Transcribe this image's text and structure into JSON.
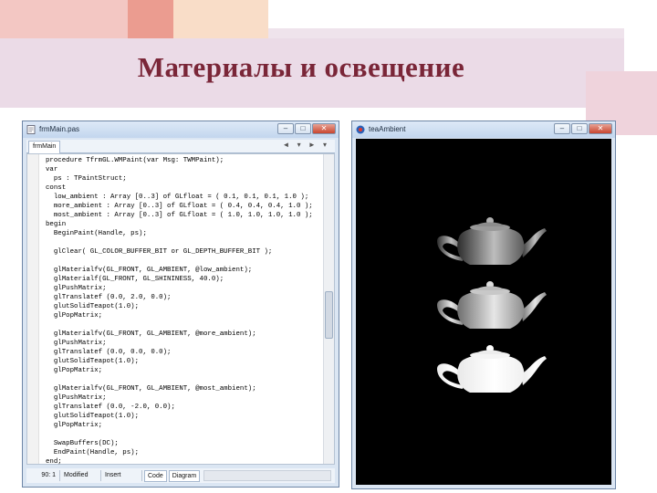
{
  "slide": {
    "title": "Материалы и освещение"
  },
  "editor": {
    "window_title": "frmMain.pas",
    "tab_label": "frmMain",
    "code_lines": [
      "procedure TfrmGL.WMPaint(var Msg: TWMPaint);",
      "var",
      "  ps : TPaintStruct;",
      "const",
      "  low_ambient : Array [0..3] of GLfloat = ( 0.1, 0.1, 0.1, 1.0 );",
      "  more_ambient : Array [0..3] of GLfloat = ( 0.4, 0.4, 0.4, 1.0 );",
      "  most_ambient : Array [0..3] of GLfloat = ( 1.0, 1.0, 1.0, 1.0 );",
      "begin",
      "  BeginPaint(Handle, ps);",
      "",
      "  glClear( GL_COLOR_BUFFER_BIT or GL_DEPTH_BUFFER_BIT );",
      "",
      "  glMaterialfv(GL_FRONT, GL_AMBIENT, @low_ambient);",
      "  glMaterialf(GL_FRONT, GL_SHININESS, 40.0);",
      "  glPushMatrix;",
      "  glTranslatef (0.0, 2.0, 0.0);",
      "  glutSolidTeapot(1.0);",
      "  glPopMatrix;",
      "",
      "  glMaterialfv(GL_FRONT, GL_AMBIENT, @more_ambient);",
      "  glPushMatrix;",
      "  glTranslatef (0.0, 0.0, 0.0);",
      "  glutSolidTeapot(1.0);",
      "  glPopMatrix;",
      "",
      "  glMaterialfv(GL_FRONT, GL_AMBIENT, @most_ambient);",
      "  glPushMatrix;",
      "  glTranslatef (0.0, -2.0, 0.0);",
      "  glutSolidTeapot(1.0);",
      "  glPopMatrix;",
      "",
      "  SwapBuffers(DC);",
      "  EndPaint(Handle, ps);",
      "end;"
    ],
    "status": {
      "position": "90: 1",
      "state": "Modified",
      "mode": "Insert",
      "tab_code": "Code",
      "tab_diagram": "Diagram"
    },
    "nav_glyphs": "◄ ▾ ► ▾"
  },
  "render_window": {
    "window_title": "teaAmbient"
  },
  "window_buttons": {
    "minimize": "–",
    "maximize": "□",
    "close": "✕"
  }
}
